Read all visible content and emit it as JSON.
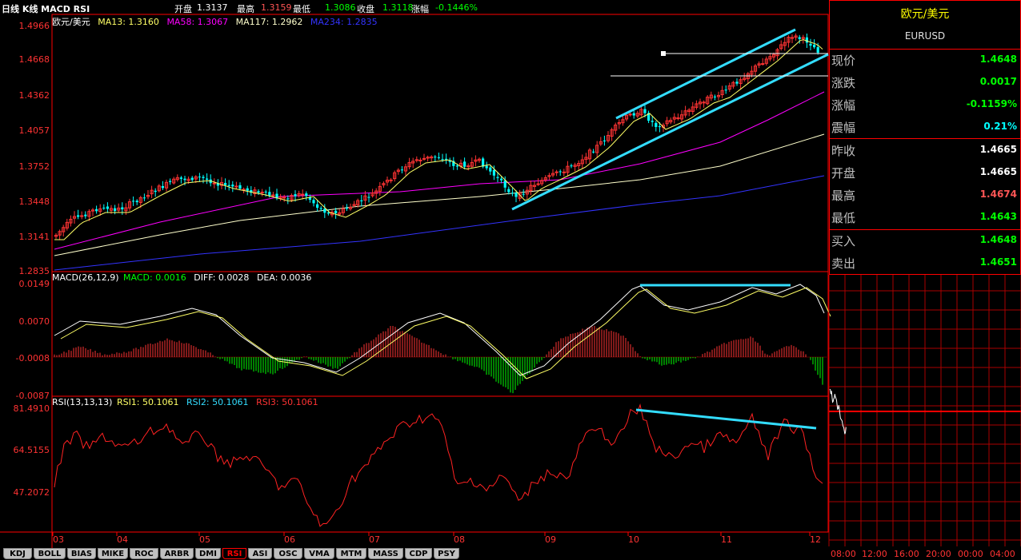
{
  "topbar": {
    "period": "日线 K线 MACD RSI",
    "open_label": "开盘",
    "open": "1.3137",
    "high_label": "最高",
    "high": "1.3159",
    "low_label": "最低",
    "low": "1.3086",
    "close_label": "收盘",
    "close": "1.3118",
    "change_label": "涨幅",
    "change": "-0.1446%"
  },
  "main": {
    "instrument": "欧元/美元",
    "ma13": "MA13: 1.3160",
    "ma58": "MA58: 1.3067",
    "ma117": "MA117: 1.2962",
    "ma234": "MA234: 1.2835",
    "yticks": [
      "1.4966",
      "1.4668",
      "1.4362",
      "1.4057",
      "1.3752",
      "1.3448",
      "1.3141",
      "1.2835"
    ],
    "xticks": [
      "03",
      "04",
      "05",
      "06",
      "07",
      "08",
      "09",
      "10",
      "11",
      "12"
    ]
  },
  "macd": {
    "title": "MACD(26,12,9)",
    "macd": "MACD: 0.0016",
    "diff": "DIFF: 0.0028",
    "dea": "DEA: 0.0036",
    "yticks": [
      "0.0149",
      "0.0070",
      "-0.0008",
      "-0.0087"
    ]
  },
  "rsi": {
    "title": "RSI(13,13,13)",
    "rsi1": "RSI1: 50.1061",
    "rsi2": "RSI2: 50.1061",
    "rsi3": "RSI3: 50.1061",
    "yticks": [
      "81.4910",
      "64.5155",
      "47.2072"
    ]
  },
  "quote_panel": {
    "title": "欧元/美元",
    "code": "EURUSD",
    "rows": [
      {
        "label": "现价",
        "value": "1.4648",
        "color": "#00ff00"
      },
      {
        "label": "涨跌",
        "value": "0.0017",
        "color": "#00ff00"
      },
      {
        "label": "涨幅",
        "value": "-0.1159%",
        "color": "#00ff00"
      },
      {
        "label": "震幅",
        "value": "0.21%",
        "color": "#00ffff"
      },
      {
        "label": "昨收",
        "value": "1.4665",
        "color": "#ffffff"
      },
      {
        "label": "开盘",
        "value": "1.4665",
        "color": "#ffffff"
      },
      {
        "label": "最高",
        "value": "1.4674",
        "color": "#ff5555"
      },
      {
        "label": "最低",
        "value": "1.4643",
        "color": "#00ff00"
      },
      {
        "label": "买入",
        "value": "1.4648",
        "color": "#00ff00"
      },
      {
        "label": "卖出",
        "value": "1.4651",
        "color": "#00ff00"
      }
    ]
  },
  "intraday": {
    "times": [
      "08:00",
      "12:00",
      "16:00",
      "20:00",
      "00:00",
      "04:00"
    ]
  },
  "tabs": [
    "KDJ",
    "BOLL",
    "BIAS",
    "MIKE",
    "ROC",
    "ARBR",
    "DMI",
    "RSI",
    "ASI",
    "OSC",
    "VMA",
    "MTM",
    "MASS",
    "CDP",
    "PSY"
  ],
  "active_tab": "RSI",
  "colors": {
    "ma13": "#ffff66",
    "ma58": "#ff00ff",
    "ma117": "#ffffcc",
    "ma234": "#3333ff",
    "trendline": "#33ddff",
    "grid": "#880000",
    "up": "#ff3333",
    "down": "#00ffff"
  }
}
